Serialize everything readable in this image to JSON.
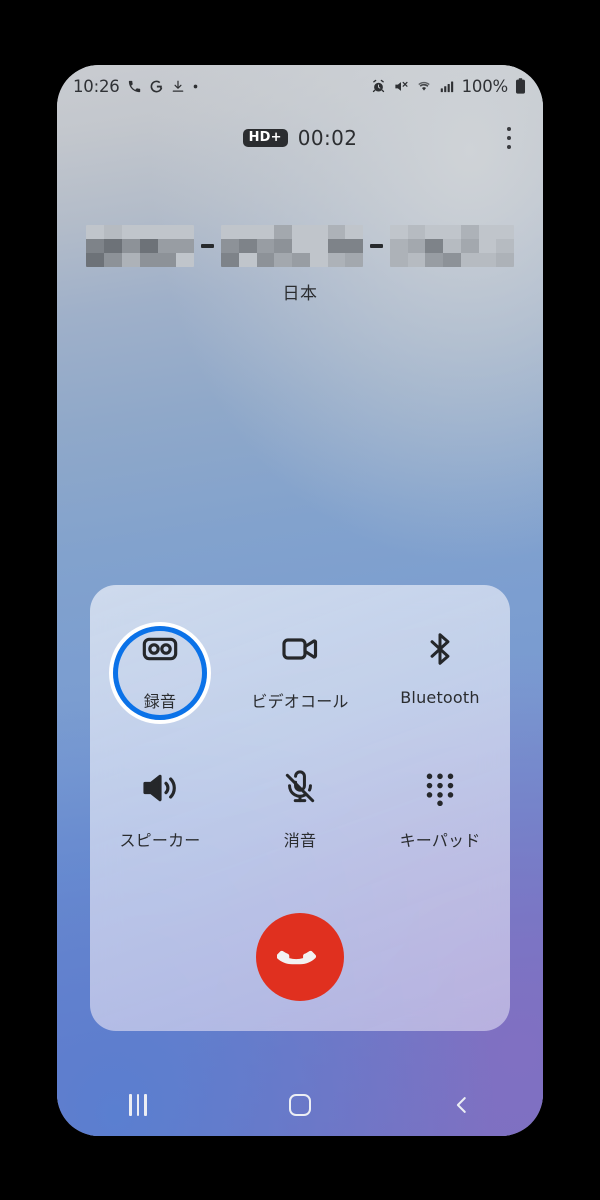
{
  "status_bar": {
    "time": "10:26",
    "battery_percent": "100%",
    "left_icons": [
      "phone-call-icon",
      "google-g-icon",
      "download-icon",
      "dot-icon"
    ],
    "right_icons": [
      "alarm-icon",
      "volume-mute-icon",
      "wifi-icon",
      "signal-bars-icon",
      "battery-icon"
    ]
  },
  "call_header": {
    "hd_badge": "HD+",
    "timer": "00:02",
    "overflow_icon": "more-vertical-icon"
  },
  "caller": {
    "number_redacted": true,
    "number_separator": "-",
    "country": "日本"
  },
  "controls": {
    "buttons": [
      {
        "label": "録音",
        "icon": "voicemail-record-icon",
        "active": true
      },
      {
        "label": "ビデオコール",
        "icon": "video-call-icon",
        "active": false
      },
      {
        "label": "Bluetooth",
        "icon": "bluetooth-icon",
        "active": false
      },
      {
        "label": "スピーカー",
        "icon": "speaker-icon",
        "active": false
      },
      {
        "label": "消音",
        "icon": "microphone-mute-icon",
        "active": false
      },
      {
        "label": "キーパッド",
        "icon": "keypad-icon",
        "active": false
      }
    ],
    "end_call": {
      "icon": "end-call-icon",
      "color": "#e0301f"
    },
    "highlight_color": "#0b72e8"
  },
  "nav_bar": {
    "recents": "recents-icon",
    "home": "home-icon",
    "back": "back-chevron-icon"
  }
}
